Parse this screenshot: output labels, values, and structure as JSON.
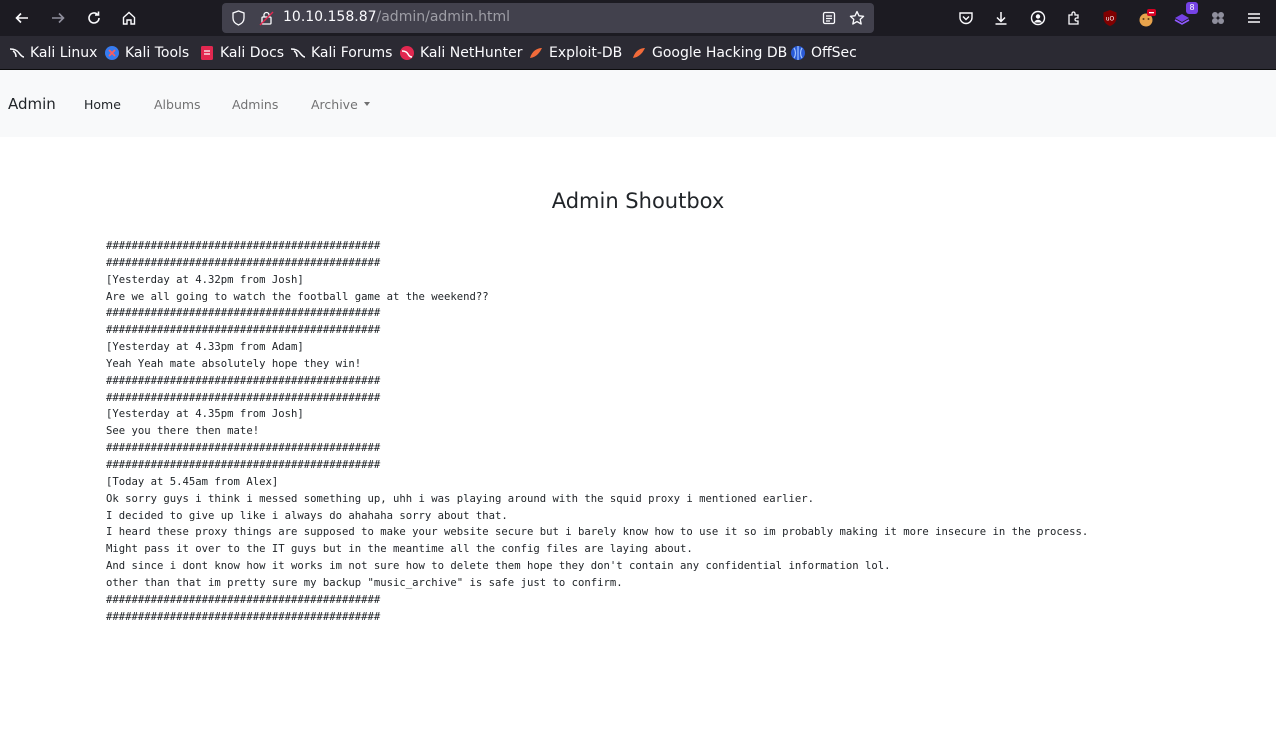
{
  "browser": {
    "url_host": "10.10.158.87",
    "url_path": "/admin/admin.html",
    "extension_badge": "8",
    "toolbar_icons": [
      "back-icon",
      "forward-icon",
      "reload-icon",
      "home-icon",
      "shield-icon",
      "lock-icon",
      "reader-mode-icon",
      "bookmark-star-icon",
      "pocket-icon",
      "download-icon",
      "account-icon",
      "extensions-icon",
      "ublock-icon",
      "extension-icon",
      "extension-purple-icon",
      "extension-puzzle-icon",
      "menu-icon"
    ]
  },
  "bookmarks": [
    {
      "label": "Kali Linux",
      "icon": "kali-dragon-icon"
    },
    {
      "label": "Kali Tools",
      "icon": "kali-tools-icon"
    },
    {
      "label": "Kali Docs",
      "icon": "kali-docs-icon"
    },
    {
      "label": "Kali Forums",
      "icon": "kali-dragon-icon"
    },
    {
      "label": "Kali NetHunter",
      "icon": "nethunter-icon"
    },
    {
      "label": "Exploit-DB",
      "icon": "exploit-db-icon"
    },
    {
      "label": "Google Hacking DB",
      "icon": "ghdb-icon"
    },
    {
      "label": "OffSec",
      "icon": "offsec-icon"
    }
  ],
  "navbar": {
    "brand": "Admin",
    "links": [
      {
        "label": "Home",
        "active": true
      },
      {
        "label": "Albums",
        "active": false
      },
      {
        "label": "Admins",
        "active": false
      },
      {
        "label": "Archive",
        "active": false,
        "dropdown": true
      }
    ]
  },
  "page": {
    "title": "Admin Shoutbox",
    "lines": [
      "###########################################",
      "###########################################",
      "[Yesterday at 4.32pm from Josh]",
      "Are we all going to watch the football game at the weekend??",
      "###########################################",
      "###########################################",
      "[Yesterday at 4.33pm from Adam]",
      "Yeah Yeah mate absolutely hope they win!",
      "###########################################",
      "###########################################",
      "[Yesterday at 4.35pm from Josh]",
      "See you there then mate!",
      "###########################################",
      "###########################################",
      "[Today at 5.45am from Alex]",
      "Ok sorry guys i think i messed something up, uhh i was playing around with the squid proxy i mentioned earlier.",
      "I decided to give up like i always do ahahaha sorry about that.",
      "I heard these proxy things are supposed to make your website secure but i barely know how to use it so im probably making it more insecure in the process.",
      "Might pass it over to the IT guys but in the meantime all the config files are laying about.",
      "And since i dont know how it works im not sure how to delete them hope they don't contain any confidential information lol.",
      "other than that im pretty sure my backup \"music_archive\" is safe just to confirm.",
      "###########################################",
      "###########################################"
    ]
  },
  "colors": {
    "toolbar_bg": "#1c1b22",
    "urlbar_bg": "#42414d",
    "bookmarks_bg": "#2b2a33",
    "navbar_bg": "#f8f9fa",
    "text": "#212529"
  }
}
